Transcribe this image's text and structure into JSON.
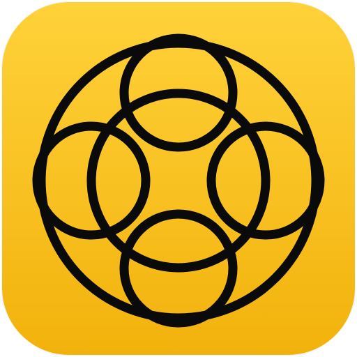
{
  "icon": {
    "name": "app-icon",
    "symbol": "interlocking-circles-emblem-icon",
    "colors": {
      "background_top": "#FFD23A",
      "background_bottom": "#F2B20C",
      "stroke": "#0A0A0A"
    }
  }
}
